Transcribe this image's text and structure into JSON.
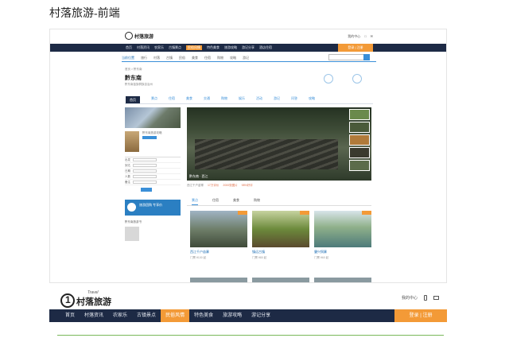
{
  "doc_title": "村落旅游-前端",
  "shot": {
    "logo_text": "村落旅游",
    "util": [
      "我的中心",
      "□",
      "✉"
    ],
    "nav": [
      "首页",
      "村落资讯",
      "农家乐",
      "古镇景点",
      "民俗风情",
      "特色美食",
      "旅游攻略",
      "游记分享",
      "酒店住宿"
    ],
    "nav_active": "民俗风情",
    "login": "登录 | 注册",
    "sub_nav": [
      "当前位置",
      "旅行",
      "村落",
      "古镇",
      "民俗",
      "美食",
      "住宿",
      "购物",
      "攻略",
      "游记"
    ],
    "breadcrumb": "首页 > 黔东南",
    "place_name": "黔东南",
    "place_sub": "黔东南苗族侗族自治州",
    "tabs": [
      "首页",
      "景点",
      "住宿",
      "美食",
      "交通",
      "购物",
      "娱乐",
      "活动",
      "游记",
      "问答",
      "攻略"
    ],
    "tab_active": "首页",
    "book_title": "黔东南旅游攻略",
    "form_labels": [
      "出发",
      "到达",
      "日期",
      "人数",
      "备注"
    ],
    "banner_text": "旅游团购 专享价",
    "book2_title": "黔东南旅游书",
    "main_caption": "黔东南 · 西江",
    "meta_text": "西江千户苗寨",
    "meta_tags": [
      "17万评价",
      "2000张图片",
      "98%好评"
    ],
    "cat_tabs": [
      "景点",
      "住宿",
      "美食",
      "购物"
    ],
    "cards": [
      {
        "name": "西江千户苗寨",
        "sub": "门票 ¥100 起"
      },
      {
        "name": "镇远古镇",
        "sub": "门票 ¥80 起"
      },
      {
        "name": "肇兴侗寨",
        "sub": "门票 ¥60 起"
      }
    ]
  },
  "bottom": {
    "logo_text": "村落旅游",
    "logo_tag": "Travel",
    "util_text": "我的中心",
    "nav": [
      "首页",
      "村落资讯",
      "农家乐",
      "古镇景点",
      "民俗风情",
      "特色美食",
      "旅游攻略",
      "游记分享"
    ],
    "nav_active": "民俗风情",
    "login": "登录 | 注册"
  },
  "colors": {
    "nav_bg": "#1d2a45",
    "accent": "#f39a37",
    "link": "#3a8fd8",
    "rule": "#7ab85a"
  }
}
